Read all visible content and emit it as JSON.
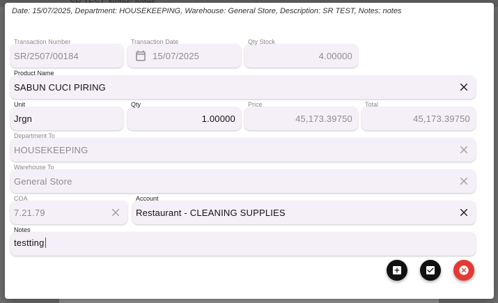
{
  "background": {
    "peek_text": "SR TEST, Notes: notes"
  },
  "dialog": {
    "summary": "Date: 15/07/2025, Department: HOUSEKEEPING, Warehouse: General Store, Description: SR TEST, Notes: notes"
  },
  "fields": {
    "transaction_number": {
      "label": "Transaction Number",
      "value": "SR/2507/00184"
    },
    "transaction_date": {
      "label": "Transaction Date",
      "value": "15/07/2025",
      "icon": "calendar-icon"
    },
    "qty_stock": {
      "label": "Qty Stock",
      "value": "4.00000"
    },
    "product_name": {
      "label": "Product Name",
      "value": "SABUN CUCI PIRING",
      "icon": "close-icon"
    },
    "unit": {
      "label": "Unit",
      "value": "Jrgn"
    },
    "qty": {
      "label": "Qty",
      "value": "1.00000"
    },
    "price": {
      "label": "Price",
      "value": "45,173.39750"
    },
    "total": {
      "label": "Total",
      "value": "45,173.39750"
    },
    "department_to": {
      "label": "Department To",
      "value": "HOUSEKEEPING",
      "icon": "close-icon"
    },
    "warehouse_to": {
      "label": "Warehouse To",
      "value": "General Store",
      "icon": "close-icon"
    },
    "coa": {
      "label": "COA",
      "value": "7.21.79",
      "icon": "close-icon"
    },
    "account": {
      "label": "Account",
      "value": "Restaurant - CLEANING SUPPLIES",
      "icon": "close-icon"
    },
    "notes": {
      "label": "Notes",
      "value": "testting"
    }
  },
  "actions": {
    "add": {
      "icon": "add-box-icon",
      "color": "#111111"
    },
    "confirm": {
      "icon": "check-box-icon",
      "color": "#111111"
    },
    "cancel": {
      "icon": "cancel-icon",
      "color": "#e53935"
    }
  }
}
